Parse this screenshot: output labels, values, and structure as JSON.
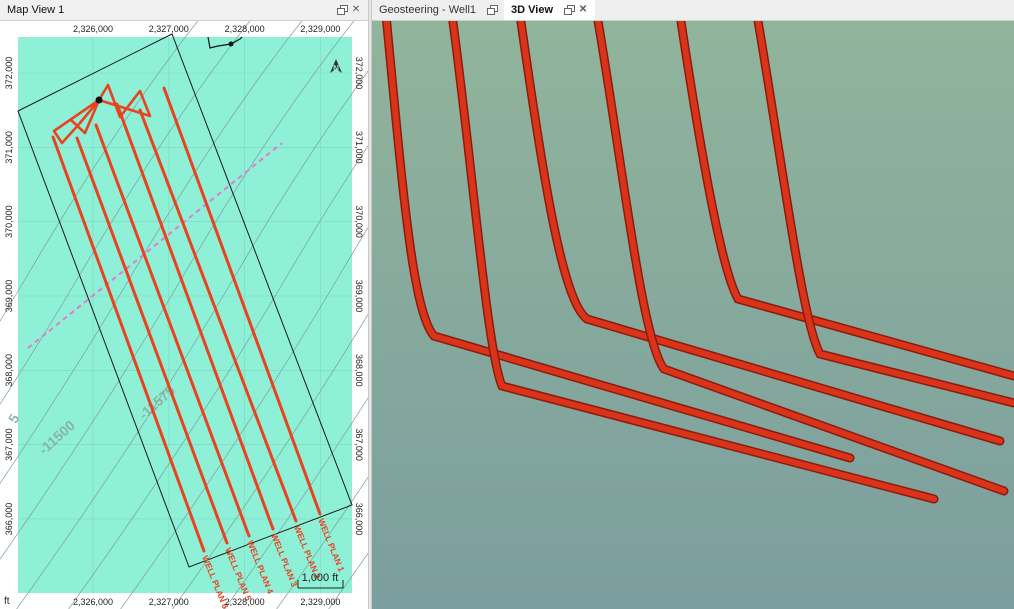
{
  "left_tab": {
    "title": "Map View 1"
  },
  "right_tabs": [
    {
      "title": "Geosteering - Well1",
      "active": false
    },
    {
      "title": "3D View",
      "active": true
    }
  ],
  "map": {
    "x_ticks": [
      {
        "value": 2326000,
        "label": "2,326,000"
      },
      {
        "value": 2327000,
        "label": "2,327,000"
      },
      {
        "value": 2328000,
        "label": "2,328,000"
      },
      {
        "value": 2329000,
        "label": "2,329,000"
      }
    ],
    "y_ticks": [
      {
        "value": 372000,
        "label": "372,000"
      },
      {
        "value": 371000,
        "label": "371,000"
      },
      {
        "value": 370000,
        "label": "370,000"
      },
      {
        "value": 369000,
        "label": "369,000"
      },
      {
        "value": 368000,
        "label": "368,000"
      },
      {
        "value": 367000,
        "label": "367,000"
      },
      {
        "value": 366000,
        "label": "366,000"
      }
    ],
    "contour_labels": [
      "-11500",
      "-11575",
      "5"
    ],
    "wells": [
      "WELL PLAN 1",
      "WELL PLAN 2",
      "WELL PLAN 3",
      "WELL PLAN 4",
      "WELL PLAN 5",
      "WELL PLAN 6"
    ],
    "scale_bar": "1,000 ft",
    "units": "ft",
    "north_label": "N",
    "colors": {
      "background": "#8ff0d8",
      "well": "#e8431e",
      "fault": "#e27ad0",
      "boundary": "#1a1a1a"
    }
  },
  "view3d": {
    "colors": {
      "top": "#91b49c",
      "bottom": "#7b9e9e",
      "pipe": "#d9341a",
      "pipe_dark": "#8c1a0d"
    }
  }
}
